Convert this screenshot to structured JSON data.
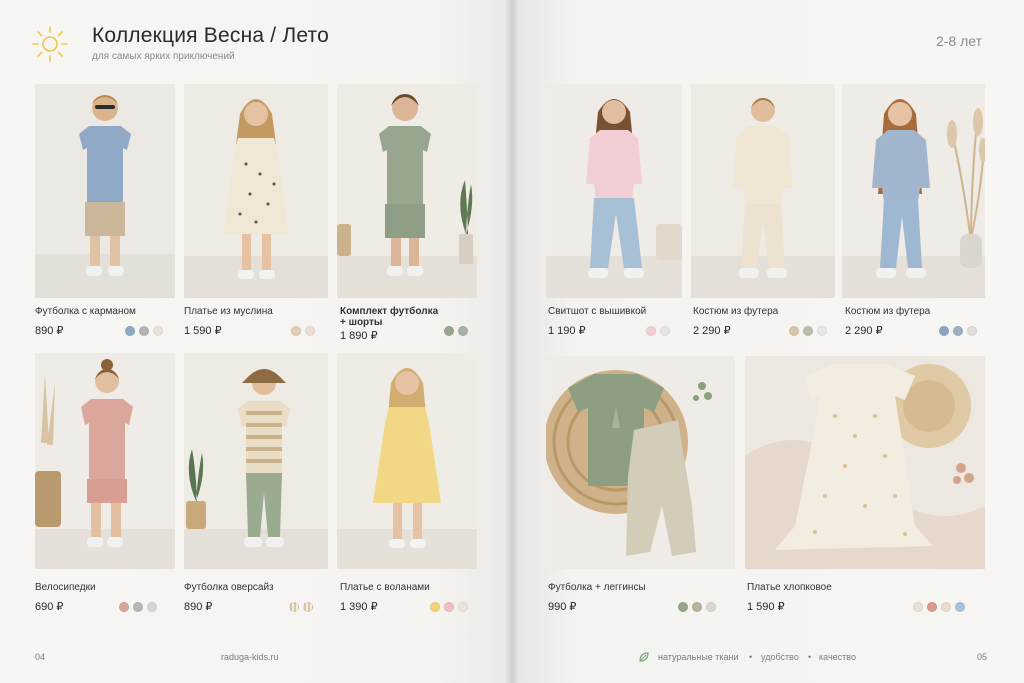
{
  "header": {
    "title": "Коллекция Весна / Лето",
    "subtitle": "для самых ярких приключений",
    "age_range": "2-8 лет",
    "icon": "sun-icon"
  },
  "colors": {
    "accent": "#f2c54d",
    "leaf": "#7aa67a"
  },
  "left_page": {
    "products": [
      {
        "name": "Футболка с карманом",
        "price": "890 ₽",
        "swatches": [
          "#8fa9c6",
          "#b5b5b5",
          "#e9e3d9"
        ]
      },
      {
        "name": "Платье из муслина",
        "price": "1 590 ₽",
        "swatches": [
          "#e3cdb6",
          "#ecdfd2"
        ]
      },
      {
        "name": "Комплект футболка + шорты",
        "price": "1 890 ₽",
        "swatches": [
          "#98a68f",
          "#a7b1a6"
        ]
      },
      {
        "name": "Велосипедки",
        "price": "690 ₽",
        "swatches": [
          "#dba79d",
          "#b7b7b7",
          "#d6d6d6"
        ]
      },
      {
        "name": "Футболка оверсайз",
        "price": "890 ₽",
        "swatches": [
          "striped-beige",
          "striped-beige"
        ]
      },
      {
        "name": "Платье с воланами",
        "price": "1 390 ₽",
        "swatches": [
          "#f2d27a",
          "#eec1c1",
          "#ece4dc"
        ]
      }
    ],
    "page_number": "04",
    "website": "raduga-kids.ru"
  },
  "right_page": {
    "products": [
      {
        "name": "Свитшот с вышивкой",
        "price": "1 190 ₽",
        "swatches": [
          "#f2cfd4",
          "#e8e6e2"
        ]
      },
      {
        "name": "Костюм из футера",
        "price": "2 290 ₽",
        "swatches": [
          "#d8c6a8",
          "#b8bfaa",
          "#e6e6e6"
        ]
      },
      {
        "name": "Костюм из футера",
        "price": "2 290 ₽",
        "swatches": [
          "#8fa6c3",
          "#9db0bf",
          "#dedede"
        ]
      },
      {
        "name": "Футболка + леггинсы",
        "price": "990 ₽",
        "swatches": [
          "#98a38c",
          "#b9b39b",
          "#d9d6cd"
        ]
      },
      {
        "name": "Платье хлопковое",
        "price": "1 590 ₽",
        "swatches": [
          "#ece1d6",
          "#d99a8a",
          "#e9dccd",
          "#a9c3dd"
        ]
      }
    ],
    "footer": {
      "benefit_1": "натуральные ткани",
      "separator": "•",
      "benefit_2": "удобство",
      "benefit_3": "качество"
    },
    "page_number": "05"
  }
}
